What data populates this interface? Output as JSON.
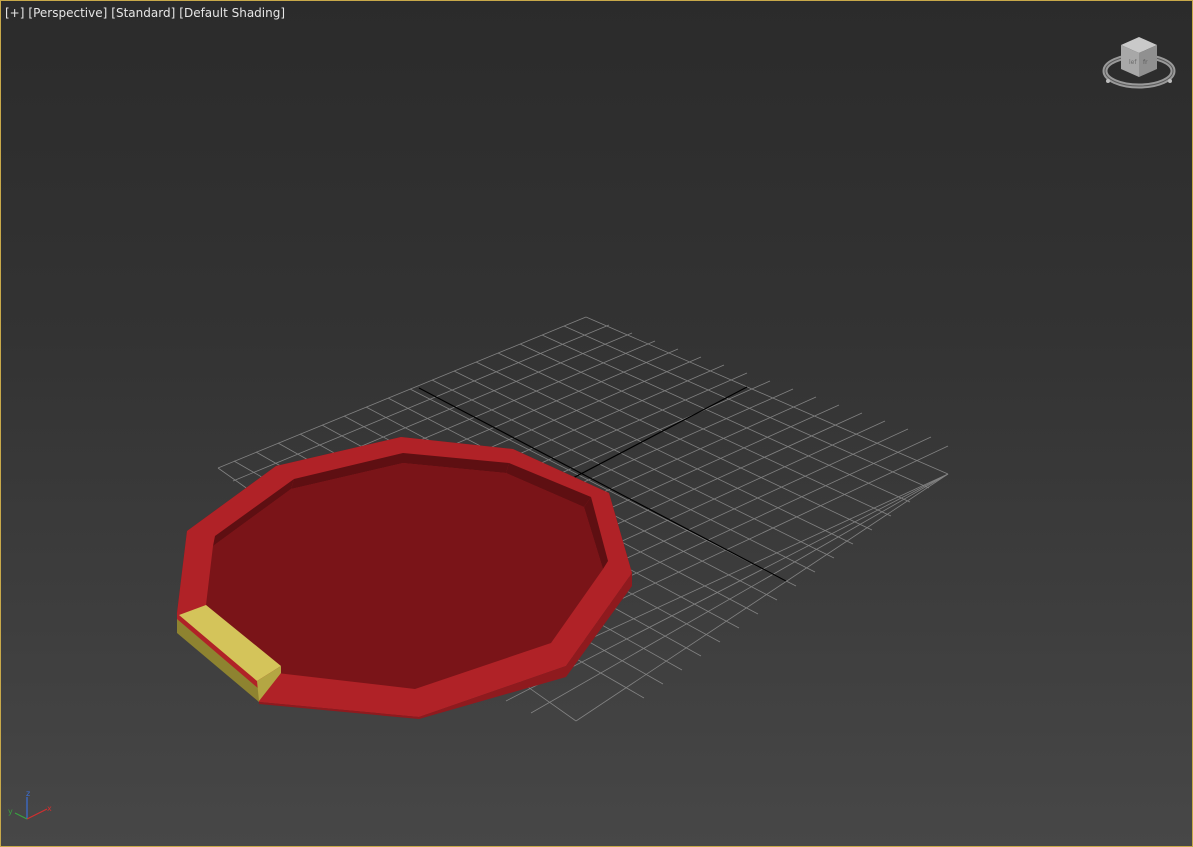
{
  "viewport": {
    "labels": {
      "plus": "[+]",
      "view": "[Perspective]",
      "mode": "[Standard]",
      "shading": "[Default Shading]"
    },
    "viewcube_icon": "viewcube-icon",
    "axis_labels": {
      "x": "x",
      "y": "y",
      "z": "z"
    },
    "colors": {
      "frame_border": "#c8a94a",
      "background_top": "#2b2b2b",
      "background_bottom": "#474747",
      "grid": "#8a8a8a",
      "grid_axis": "#000000",
      "ring": "#b02227",
      "ring_dark": "#7a1418",
      "selected_segment": "#d4c45a",
      "selected_segment_dark": "#8e8330"
    }
  }
}
